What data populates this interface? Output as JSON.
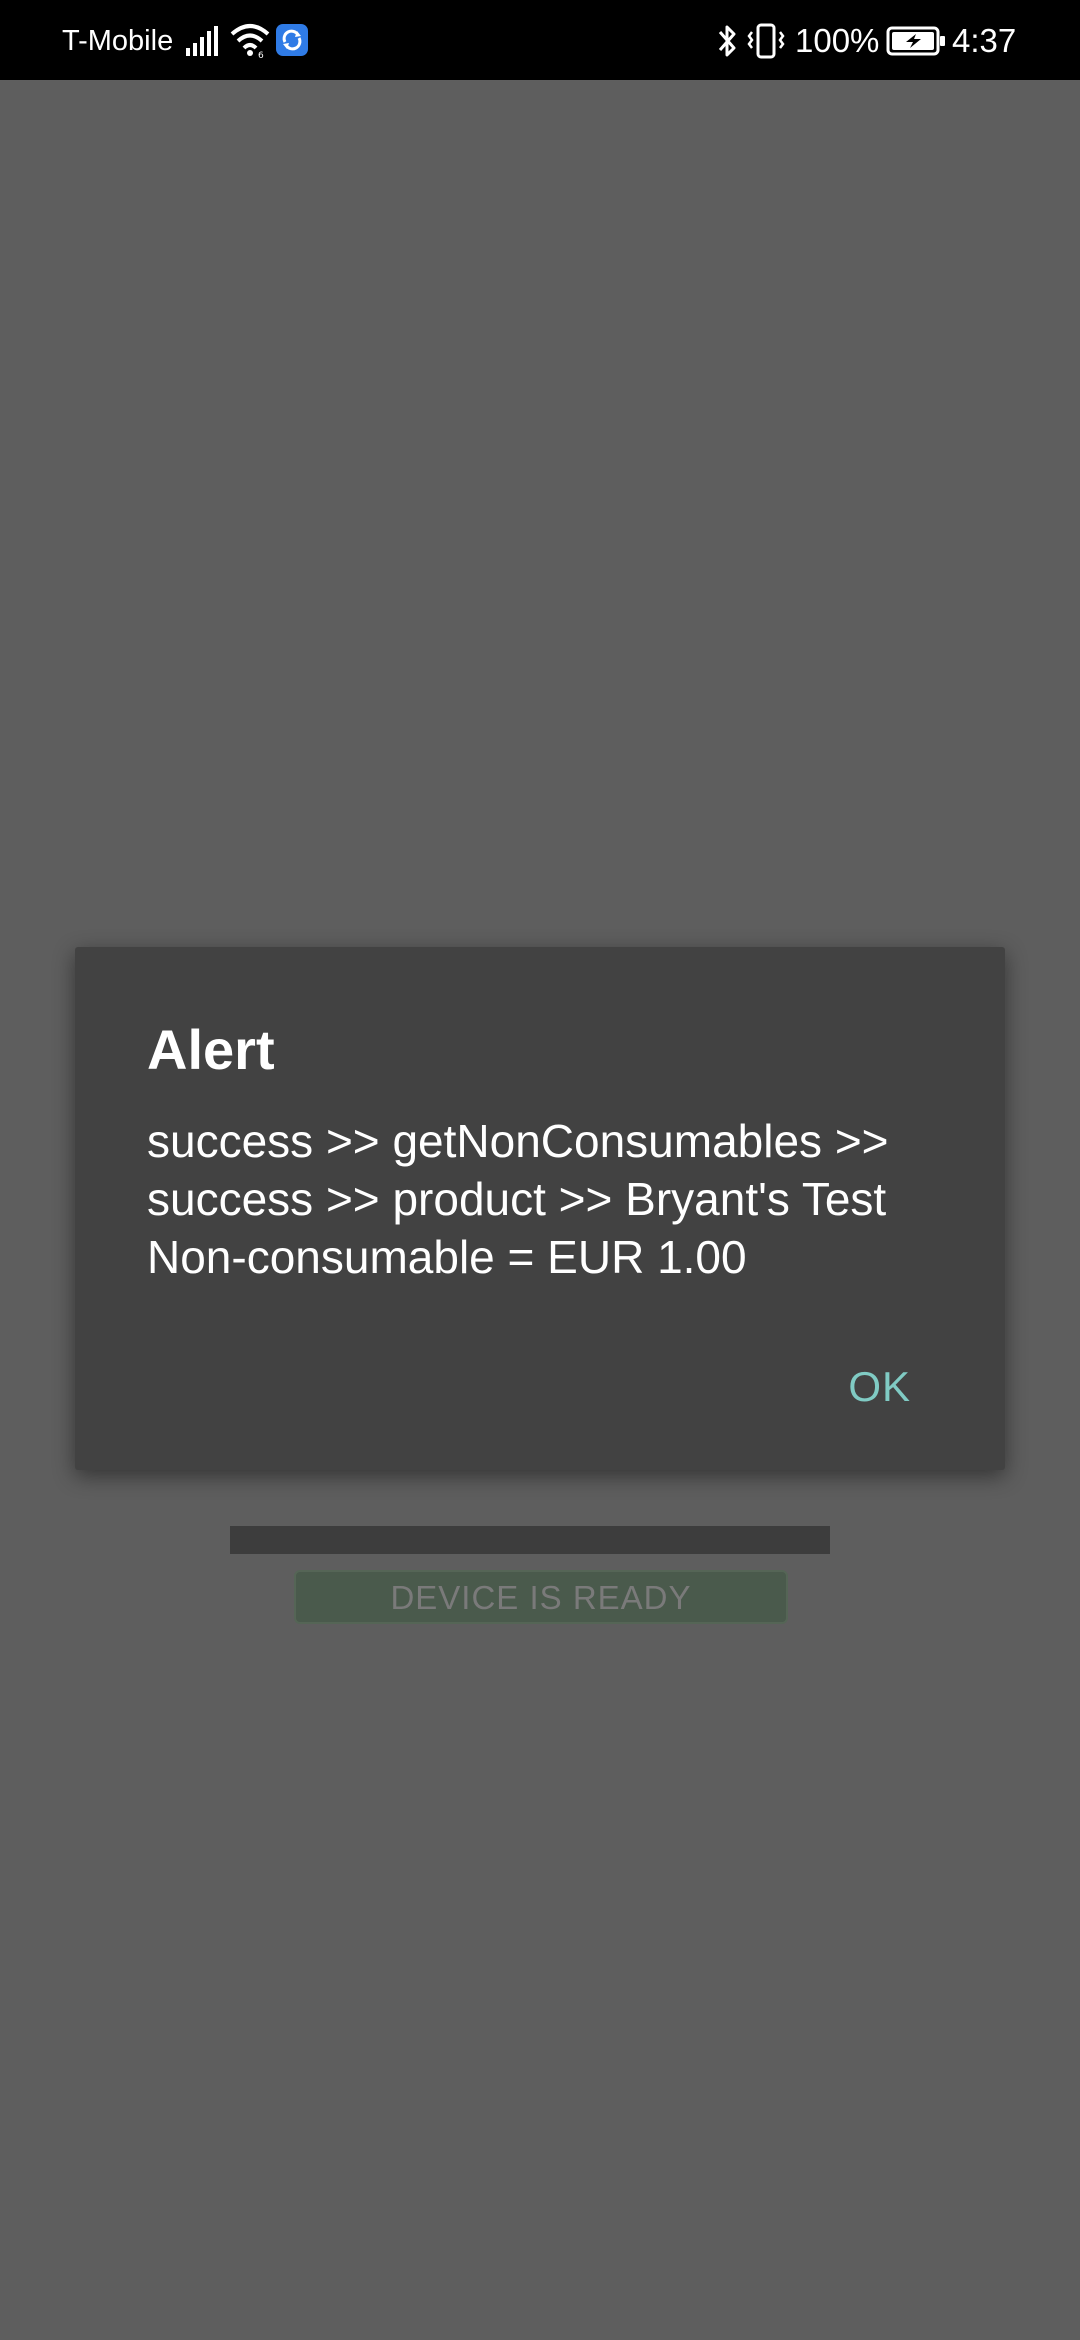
{
  "status_bar": {
    "carrier": "T-Mobile",
    "battery_percent": "100%",
    "time": "4:37",
    "icons": [
      "signal-icon",
      "wifi-icon",
      "app-notification-icon",
      "bluetooth-icon",
      "vibrate-icon",
      "battery-charging-icon"
    ]
  },
  "background": {
    "device_status": "DEVICE IS READY",
    "overlay_color": "#5e5e5e"
  },
  "dialog": {
    "title": "Alert",
    "message": "success >> getNonConsumables >> success >> product >> Bryant's Test Non-consumable = EUR 1.00",
    "ok_label": "OK",
    "accent_color": "#80cbc4"
  }
}
